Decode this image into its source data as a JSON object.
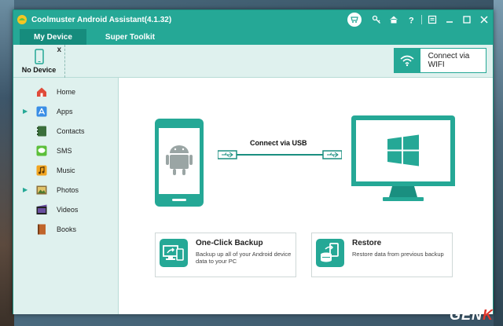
{
  "window": {
    "title": "Coolmuster Android Assistant(4.1.32)"
  },
  "tabs": [
    {
      "label": "My Device"
    },
    {
      "label": "Super Toolkit"
    }
  ],
  "device": {
    "label": "No Device",
    "close": "x"
  },
  "wifi": {
    "label": "Connect via WIFI"
  },
  "sidebar": {
    "items": [
      {
        "label": "Home",
        "icon": "home-icon",
        "color": "#e04b3a",
        "arrow": ""
      },
      {
        "label": "Apps",
        "icon": "apps-icon",
        "color": "#3a8ee6",
        "arrow": "▶"
      },
      {
        "label": "Contacts",
        "icon": "contacts-icon",
        "color": "#3b6f3b",
        "arrow": ""
      },
      {
        "label": "SMS",
        "icon": "sms-icon",
        "color": "#5cbf3a",
        "arrow": ""
      },
      {
        "label": "Music",
        "icon": "music-icon",
        "color": "#f2a521",
        "arrow": ""
      },
      {
        "label": "Photos",
        "icon": "photos-icon",
        "color": "#8b6f3a",
        "arrow": "▶"
      },
      {
        "label": "Videos",
        "icon": "videos-icon",
        "color": "#6a4fa0",
        "arrow": ""
      },
      {
        "label": "Books",
        "icon": "books-icon",
        "color": "#c0652b",
        "arrow": ""
      }
    ]
  },
  "connect": {
    "usb_label": "Connect via USB"
  },
  "backup": {
    "title": "One-Click Backup",
    "desc": "Backup up all of your Android device data to your PC"
  },
  "restore": {
    "title": "Restore",
    "desc": "Restore data from previous backup"
  },
  "watermark": {
    "text": "GEN",
    "accent": "K"
  },
  "colors": {
    "accent": "#25a896",
    "dark_accent": "#168c7d",
    "sidebar_bg": "#dff1ee"
  }
}
